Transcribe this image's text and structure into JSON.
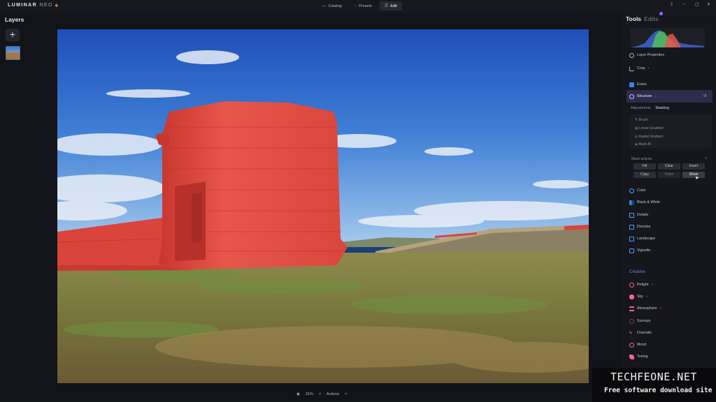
{
  "app": {
    "name": "LUMINAR",
    "name_suffix": "NEO"
  },
  "top_nav": [
    {
      "label": "Catalog",
      "icon": "folder-icon"
    },
    {
      "label": "Presets",
      "icon": "presets-icon"
    },
    {
      "label": "Edit",
      "icon": "sliders-icon",
      "active": true
    }
  ],
  "layers": {
    "title": "Layers",
    "add_label": "+"
  },
  "bottom_bar": {
    "zoom": "31%",
    "actions_label": "Actions"
  },
  "panel": {
    "tab_tools": "Tools",
    "tab_edits": "Edits",
    "tools_top": [
      {
        "label": "Layer Properties",
        "icon": "layers-icon"
      },
      {
        "label": "Crop",
        "icon": "crop-icon",
        "caret": "^"
      },
      {
        "label": "Erase",
        "icon": "erase-icon"
      },
      {
        "label": "Structure",
        "icon": "structure-icon",
        "caret": "^"
      }
    ],
    "subtabs": {
      "adjustments": "Adjustments",
      "masking": "Masking"
    },
    "mask_items": [
      "Brush",
      "Linear Gradient",
      "Radial Gradient",
      "Mask AI"
    ],
    "mask_actions": {
      "title": "Mask actions",
      "buttons": [
        {
          "label": "Fill"
        },
        {
          "label": "Clear"
        },
        {
          "label": "Invert"
        },
        {
          "label": "Copy"
        },
        {
          "label": "Paste"
        },
        {
          "label": "Show"
        }
      ]
    },
    "tools_essentials": [
      {
        "label": "Color",
        "icon": "color-icon"
      },
      {
        "label": "Black & White",
        "icon": "bw-icon"
      },
      {
        "label": "Details",
        "icon": "details-icon"
      },
      {
        "label": "Denoise",
        "icon": "denoise-icon"
      },
      {
        "label": "Landscape",
        "icon": "landscape-icon"
      },
      {
        "label": "Vignette",
        "icon": "vignette-icon"
      }
    ],
    "creative_title": "Creative",
    "tools_creative": [
      {
        "label": "Relight",
        "icon": "relight-icon",
        "caret": "^"
      },
      {
        "label": "Sky",
        "icon": "sky-icon",
        "caret": "^"
      },
      {
        "label": "Atmosphere",
        "icon": "atmosphere-icon",
        "caret": "^"
      },
      {
        "label": "Sunrays",
        "icon": "sunrays-icon"
      },
      {
        "label": "Dramatic",
        "icon": "dramatic-icon"
      },
      {
        "label": "Mood",
        "icon": "mood-icon"
      },
      {
        "label": "Toning",
        "icon": "toning-icon"
      }
    ]
  },
  "watermark": {
    "title": "TECHFEONE.NET",
    "subtitle": "Free software download site"
  },
  "colors": {
    "mask_red": "#e2453e",
    "accent_purple": "#8b6cf0",
    "structure_band": "#2e2a4a"
  }
}
